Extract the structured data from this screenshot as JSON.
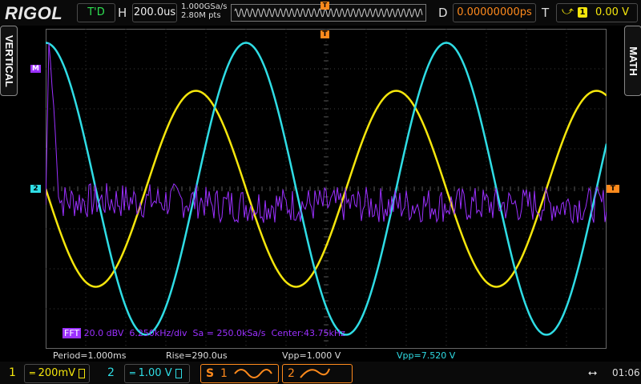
{
  "brand": "RIGOL",
  "status": "T'D",
  "top": {
    "h_label": "H",
    "timebase": "200.0us",
    "sample_rate": "1.000GSa/s",
    "memory_depth": "2.80M pts",
    "d_label": "D",
    "delay": "0.00000000ps",
    "t_label": "T",
    "trigger_source": "1",
    "trigger_level": "0.00 V",
    "trigger_edge_icon": "rising-edge-icon"
  },
  "side": {
    "left_tab": "VERTICAL",
    "right_tab": "MATH"
  },
  "markers": {
    "math": "M",
    "ch2": "2",
    "trigger_level": "T",
    "trigger_position": "T"
  },
  "fft": {
    "tag": "FFT",
    "info": " 20.0 dBV  6.250kHz/div  Sa = 250.0kSa/s  Center:43.75kHz"
  },
  "measurements": {
    "period": "Period=1.000ms",
    "rise": "Rise=290.0us",
    "vpp1": "Vpp=1.000 V",
    "vpp2": "Vpp=7.520 V"
  },
  "bottom": {
    "ch1_num": "1",
    "ch1_scale": "200mV",
    "ch2_num": "2",
    "ch2_scale": "1.00 V",
    "coupling_icon": "dc-coupling-icon",
    "math_s": "S",
    "math_1": "1",
    "math_2": "2",
    "clock": "01:06"
  },
  "colors": {
    "ch1": "#f5e60c",
    "ch2": "#2fdde5",
    "math": "#9b30ff",
    "trigger": "#ff8a1c"
  },
  "chart_data": {
    "type": "line",
    "grid": true,
    "x_divisions": 14,
    "y_divisions": 8,
    "series": [
      {
        "channel": "1",
        "color": "#f5e60c",
        "waveform": "sine",
        "period_div": 5,
        "amplitude_div": 2.45,
        "offset_div": 0,
        "phase_deg": 180
      },
      {
        "channel": "2",
        "color": "#2fdde5",
        "waveform": "sine",
        "period_div": 5,
        "amplitude_div": 3.65,
        "offset_div": 0,
        "phase_deg": 90
      },
      {
        "channel": "M",
        "color": "#9b30ff",
        "waveform": "fft",
        "peak_div": 3.5,
        "noise_floor_div": -0.4,
        "noise_spread_div": 0.45
      }
    ]
  }
}
